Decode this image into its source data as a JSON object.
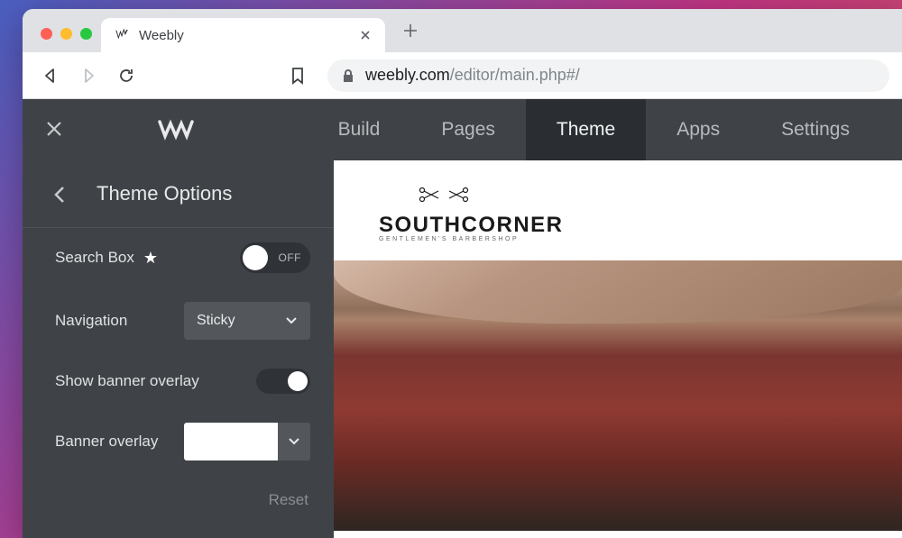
{
  "browser": {
    "tab_title": "Weebly",
    "url_domain": "weebly.com",
    "url_path": "/editor/main.php#/"
  },
  "header": {
    "nav": [
      {
        "label": "Build",
        "active": false
      },
      {
        "label": "Pages",
        "active": false
      },
      {
        "label": "Theme",
        "active": true
      },
      {
        "label": "Apps",
        "active": false
      },
      {
        "label": "Settings",
        "active": false
      }
    ]
  },
  "sidebar": {
    "title": "Theme Options",
    "options": {
      "search_box": {
        "label": "Search Box",
        "value": "OFF"
      },
      "navigation": {
        "label": "Navigation",
        "value": "Sticky"
      },
      "banner_overlay_show": {
        "label": "Show banner overlay",
        "value": "ON"
      },
      "banner_overlay_color": {
        "label": "Banner overlay",
        "value": "#ffffff"
      }
    },
    "reset_label": "Reset"
  },
  "preview": {
    "brand_title": "SOUTHCORNER",
    "brand_subtitle": "GENTLEMEN'S BARBERSHOP"
  }
}
